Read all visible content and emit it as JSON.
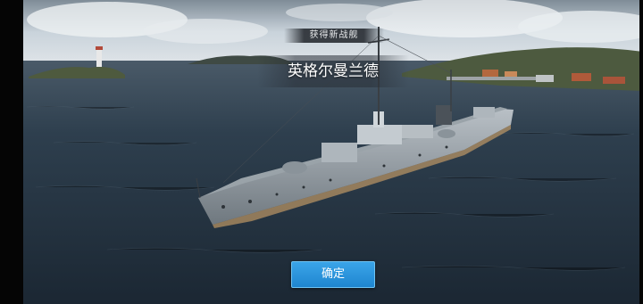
{
  "dialog": {
    "subtitle": "获得新战舰",
    "ship_name": "英格尔曼兰德",
    "confirm_label": "确定"
  },
  "colors": {
    "button_top": "#3aa4e8",
    "button_bottom": "#1f86d0",
    "sea": "#2a3b4a",
    "sky": "#c9d3db"
  }
}
